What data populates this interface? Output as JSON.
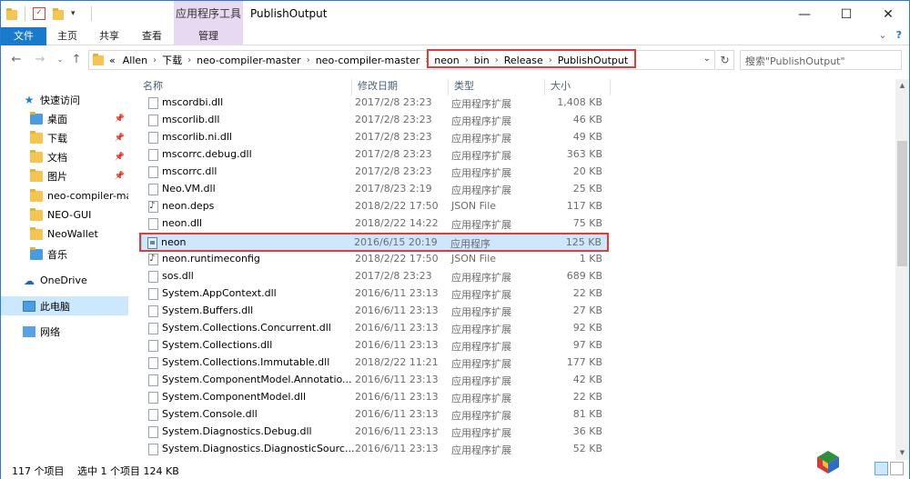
{
  "window": {
    "title": "PublishOutput",
    "contextual_group": "应用程序工具"
  },
  "ribbon": {
    "tabs": [
      "文件",
      "主页",
      "共享",
      "查看",
      "管理"
    ]
  },
  "address": {
    "crumbs": [
      "«",
      "Allen",
      "下载",
      "neo-compiler-master",
      "neo-compiler-master",
      "neon",
      "bin",
      "Release",
      "PublishOutput"
    ]
  },
  "search": {
    "placeholder": "搜索\"PublishOutput\""
  },
  "nav": {
    "quick_access": "快速访问",
    "items": [
      {
        "label": "桌面",
        "pinned": true
      },
      {
        "label": "下载",
        "pinned": true
      },
      {
        "label": "文档",
        "pinned": true
      },
      {
        "label": "图片",
        "pinned": true
      },
      {
        "label": "neo-compiler-mas",
        "pinned": false
      },
      {
        "label": "NEO-GUI",
        "pinned": false
      },
      {
        "label": "NeoWallet",
        "pinned": false
      },
      {
        "label": "音乐",
        "pinned": false
      }
    ],
    "onedrive": "OneDrive",
    "this_pc": "此电脑",
    "network": "网络"
  },
  "columns": {
    "name": "名称",
    "date": "修改日期",
    "type": "类型",
    "size": "大小"
  },
  "files": [
    {
      "name": "mscordbi.dll",
      "date": "2017/2/8 23:23",
      "type": "应用程序扩展",
      "size": "1,408 KB",
      "icon": "dll"
    },
    {
      "name": "mscorlib.dll",
      "date": "2017/2/8 23:23",
      "type": "应用程序扩展",
      "size": "46 KB",
      "icon": "dll"
    },
    {
      "name": "mscorlib.ni.dll",
      "date": "2017/2/8 23:23",
      "type": "应用程序扩展",
      "size": "49 KB",
      "icon": "dll"
    },
    {
      "name": "mscorrc.debug.dll",
      "date": "2017/2/8 23:23",
      "type": "应用程序扩展",
      "size": "363 KB",
      "icon": "dll"
    },
    {
      "name": "mscorrc.dll",
      "date": "2017/2/8 23:23",
      "type": "应用程序扩展",
      "size": "20 KB",
      "icon": "dll"
    },
    {
      "name": "Neo.VM.dll",
      "date": "2017/8/23 2:19",
      "type": "应用程序扩展",
      "size": "25 KB",
      "icon": "dll"
    },
    {
      "name": "neon.deps",
      "date": "2018/2/22 17:50",
      "type": "JSON File",
      "size": "117 KB",
      "icon": "json"
    },
    {
      "name": "neon.dll",
      "date": "2018/2/22 14:22",
      "type": "应用程序扩展",
      "size": "75 KB",
      "icon": "dll"
    },
    {
      "name": "neon",
      "date": "2016/6/15 20:19",
      "type": "应用程序",
      "size": "125 KB",
      "icon": "exe",
      "selected": true
    },
    {
      "name": "neon.runtimeconfig",
      "date": "2018/2/22 17:50",
      "type": "JSON File",
      "size": "1 KB",
      "icon": "json"
    },
    {
      "name": "sos.dll",
      "date": "2017/2/8 23:23",
      "type": "应用程序扩展",
      "size": "689 KB",
      "icon": "dll"
    },
    {
      "name": "System.AppContext.dll",
      "date": "2016/6/11 23:13",
      "type": "应用程序扩展",
      "size": "22 KB",
      "icon": "dll"
    },
    {
      "name": "System.Buffers.dll",
      "date": "2016/6/11 23:13",
      "type": "应用程序扩展",
      "size": "27 KB",
      "icon": "dll"
    },
    {
      "name": "System.Collections.Concurrent.dll",
      "date": "2016/6/11 23:13",
      "type": "应用程序扩展",
      "size": "92 KB",
      "icon": "dll"
    },
    {
      "name": "System.Collections.dll",
      "date": "2016/6/11 23:13",
      "type": "应用程序扩展",
      "size": "97 KB",
      "icon": "dll"
    },
    {
      "name": "System.Collections.Immutable.dll",
      "date": "2018/2/22 11:21",
      "type": "应用程序扩展",
      "size": "177 KB",
      "icon": "dll"
    },
    {
      "name": "System.ComponentModel.Annotatio...",
      "date": "2016/6/11 23:13",
      "type": "应用程序扩展",
      "size": "42 KB",
      "icon": "dll"
    },
    {
      "name": "System.ComponentModel.dll",
      "date": "2016/6/11 23:13",
      "type": "应用程序扩展",
      "size": "22 KB",
      "icon": "dll"
    },
    {
      "name": "System.Console.dll",
      "date": "2016/6/11 23:13",
      "type": "应用程序扩展",
      "size": "81 KB",
      "icon": "dll"
    },
    {
      "name": "System.Diagnostics.Debug.dll",
      "date": "2016/6/11 23:13",
      "type": "应用程序扩展",
      "size": "36 KB",
      "icon": "dll"
    },
    {
      "name": "System.Diagnostics.DiagnosticSourc...",
      "date": "2016/6/11 23:13",
      "type": "应用程序扩展",
      "size": "52 KB",
      "icon": "dll"
    }
  ],
  "status": {
    "count": "117 个项目",
    "selection": "选中 1 个项目  124 KB"
  },
  "colors": {
    "accent": "#1979ca",
    "context_tab": "#e8d9f3",
    "highlight": "#e23b3b",
    "selection": "#cce8ff"
  }
}
